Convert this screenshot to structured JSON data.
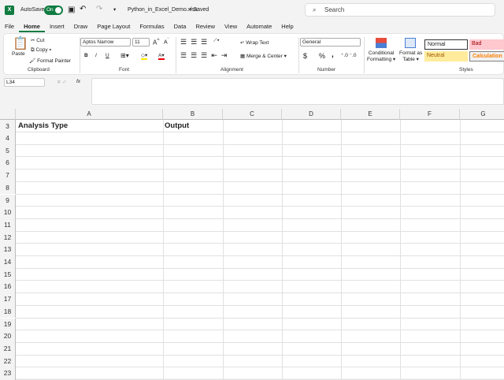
{
  "titlebar": {
    "autosave_label": "AutoSave",
    "autosave_state": "On",
    "filename": "Python_in_Excel_Demo.xlsx",
    "save_status": "• Saved",
    "search_placeholder": "Search"
  },
  "menu": [
    "File",
    "Home",
    "Insert",
    "Draw",
    "Page Layout",
    "Formulas",
    "Data",
    "Review",
    "View",
    "Automate",
    "Help"
  ],
  "ribbon": {
    "clipboard": {
      "paste": "Paste",
      "cut": "Cut",
      "copy": "Copy",
      "format_painter": "Format Painter",
      "label": "Clipboard"
    },
    "font": {
      "font_name": "Aptos Narrow",
      "font_size": "11",
      "bold": "B",
      "italic": "I",
      "underline": "U",
      "label": "Font"
    },
    "alignment": {
      "wrap": "Wrap Text",
      "merge": "Merge & Center",
      "label": "Alignment"
    },
    "number": {
      "format": "General",
      "currency": "$",
      "percent": "%",
      "comma": ",",
      "label": "Number"
    },
    "styles": {
      "conditional": "Conditional",
      "conditional2": "Formatting",
      "format_table": "Format as",
      "format_table2": "Table",
      "normal": "Normal",
      "bad": "Bad",
      "neutral": "Neutral",
      "calculation": "Calculation",
      "label": "Styles"
    }
  },
  "formula_bar": {
    "name_box": "L34",
    "formula": "",
    "fx": "fx"
  },
  "columns": [
    "A",
    "B",
    "C",
    "D",
    "E",
    "F",
    "G"
  ],
  "rows": [
    "3",
    "4",
    "5",
    "6",
    "7",
    "8",
    "9",
    "10",
    "11",
    "12",
    "13",
    "14",
    "15",
    "16",
    "17",
    "18",
    "19",
    "20",
    "21",
    "22",
    "23"
  ],
  "cells": {
    "A3": "Analysis Type",
    "B3": "Output"
  },
  "colors": {
    "accent": "#107c41",
    "bad_bg": "#ffc7ce",
    "neutral_bg": "#ffeb9c",
    "calc_text": "#fa7d00"
  }
}
